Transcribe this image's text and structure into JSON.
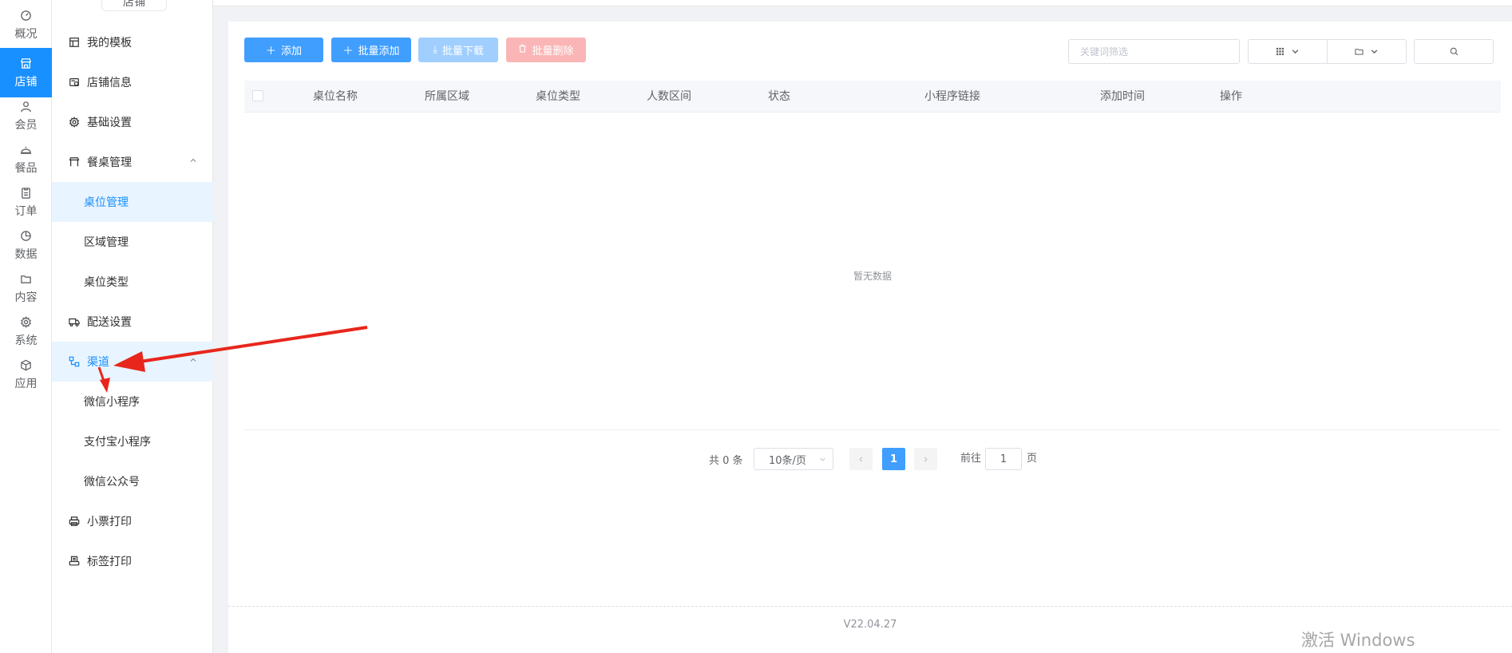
{
  "rail": {
    "items": [
      {
        "label": "概况",
        "icon": "gauge-icon"
      },
      {
        "label": "店铺",
        "icon": "store-icon",
        "active": true
      },
      {
        "label": "会员",
        "icon": "user-icon"
      },
      {
        "label": "餐品",
        "icon": "cloche-icon"
      },
      {
        "label": "订单",
        "icon": "clipboard-icon"
      },
      {
        "label": "数据",
        "icon": "pie-chart-icon"
      },
      {
        "label": "内容",
        "icon": "folder-icon"
      },
      {
        "label": "系统",
        "icon": "gear-icon"
      },
      {
        "label": "应用",
        "icon": "box-icon"
      }
    ]
  },
  "sidebar": {
    "header": "店铺",
    "items": [
      {
        "label": "我的模板",
        "icon": "template-icon"
      },
      {
        "label": "店铺信息",
        "icon": "store-info-icon"
      },
      {
        "label": "基础设置",
        "icon": "gear-icon"
      },
      {
        "label": "餐桌管理",
        "icon": "table-icon",
        "expanded": true
      },
      {
        "label": "桌位管理",
        "active": true
      },
      {
        "label": "区域管理"
      },
      {
        "label": "桌位类型"
      },
      {
        "label": "配送设置",
        "icon": "truck-icon"
      },
      {
        "label": "渠道",
        "icon": "channel-icon",
        "expanded": true,
        "highlight": true
      },
      {
        "label": "微信小程序"
      },
      {
        "label": "支付宝小程序"
      },
      {
        "label": "微信公众号"
      },
      {
        "label": "小票打印",
        "icon": "printer-icon"
      },
      {
        "label": "标签打印",
        "icon": "label-printer-icon"
      }
    ]
  },
  "toolbar": {
    "add_label": "添加",
    "batch_add_label": "批量添加",
    "batch_download_label": "批量下载",
    "batch_delete_label": "批量删除",
    "search_placeholder": "关键词筛选"
  },
  "table": {
    "columns": [
      "桌位名称",
      "所属区域",
      "桌位类型",
      "人数区间",
      "状态",
      "小程序链接",
      "添加时间",
      "操作"
    ],
    "rows": [],
    "empty_text": "暂无数据"
  },
  "pagination": {
    "total_text": "共 0 条",
    "page_size": "10条/页",
    "current_page": "1",
    "goto_label": "前往",
    "goto_value": "1",
    "goto_suffix": "页"
  },
  "footer": {
    "version": "V22.04.27"
  },
  "watermark": "激活 Windows",
  "colors": {
    "primary": "#409eff",
    "rail_active": "#1890ff",
    "danger_light": "#fab6b6",
    "annotation_arrow": "#e8261c"
  }
}
